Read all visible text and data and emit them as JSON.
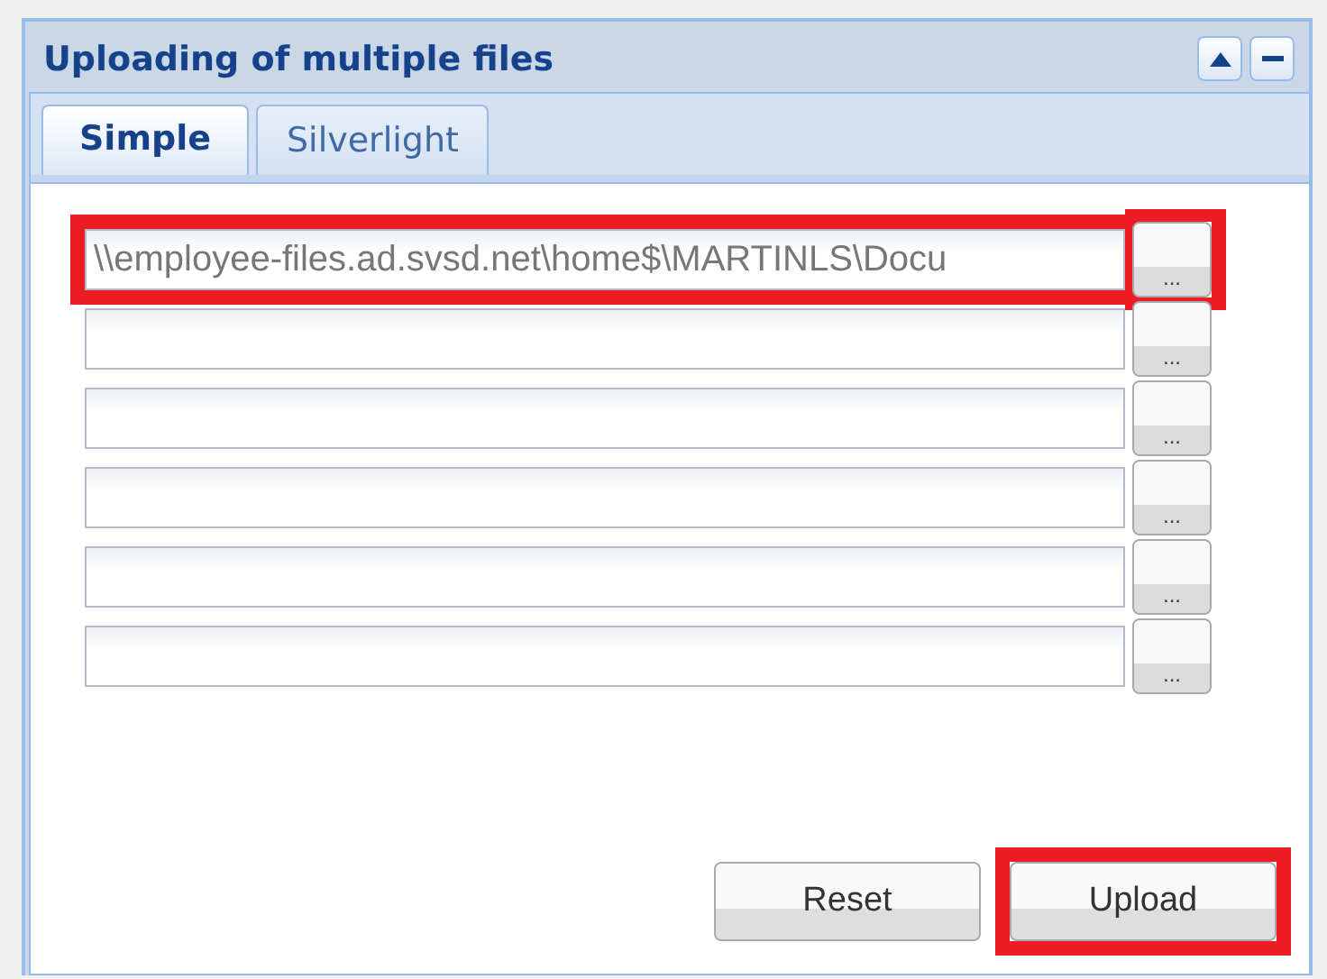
{
  "panel": {
    "title": "Uploading of multiple files",
    "header_buttons": [
      {
        "kind": "up"
      },
      {
        "kind": "minimize"
      }
    ]
  },
  "tabs": [
    {
      "label": "Simple",
      "selected": true
    },
    {
      "label": "Silverlight",
      "selected": false
    }
  ],
  "rows": [
    {
      "value": "\\\\employee-files.ad.svsd.net\\home$\\MARTINLS\\Docu",
      "browse": "...",
      "field_highlighted": true,
      "browse_highlighted": true
    },
    {
      "browse": "...",
      "field_highlighted": false,
      "browse_highlighted": false
    },
    {
      "browse": "...",
      "field_highlighted": false,
      "browse_highlighted": false
    },
    {
      "browse": "...",
      "field_highlighted": false,
      "browse_highlighted": false
    },
    {
      "browse": "...",
      "field_highlighted": false,
      "browse_highlighted": false
    },
    {
      "browse": "...",
      "field_highlighted": false,
      "browse_highlighted": false
    }
  ],
  "buttons": [
    {
      "label": "Reset",
      "highlighted": false
    },
    {
      "label": "Upload",
      "highlighted": true
    }
  ]
}
